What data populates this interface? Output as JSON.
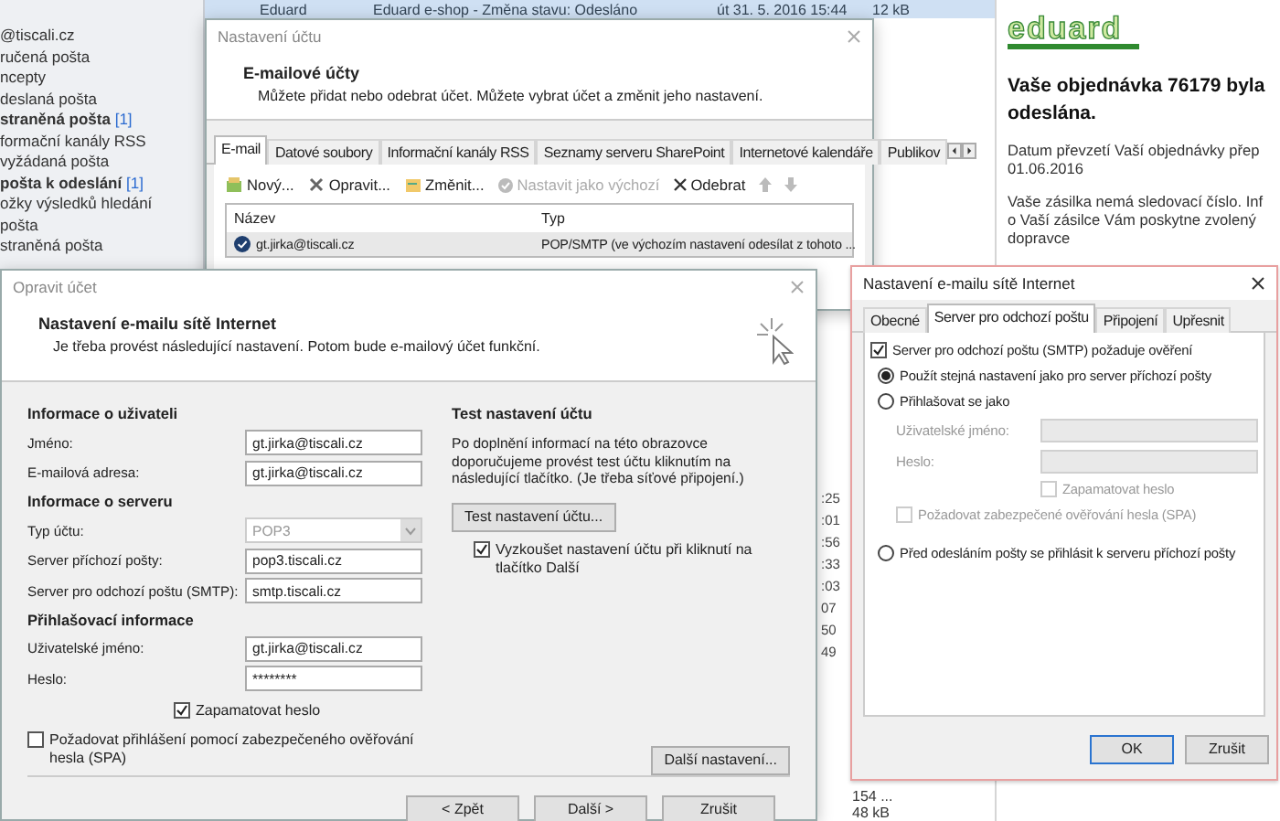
{
  "message_row": {
    "sender": "Eduard",
    "subject": "Eduard e-shop - Změna stavu: Odesláno",
    "date": "út 31. 5. 2016 15:44",
    "size": "12 kB"
  },
  "folders": [
    {
      "label": "@tiscali.cz",
      "unread": false
    },
    {
      "label": "ručená pošta",
      "unread": false
    },
    {
      "label": "ncepty",
      "unread": false
    },
    {
      "label": "deslaná pošta",
      "unread": false
    },
    {
      "label": "straněná pošta",
      "unread": true,
      "count": "[1]"
    },
    {
      "label": "formační kanály RSS",
      "unread": false
    },
    {
      "label": "vyžádaná pošta",
      "unread": false
    },
    {
      "label": "pošta k odeslání",
      "unread": true,
      "count": "[1]"
    },
    {
      "label": "ožky výsledků hledání",
      "unread": false
    },
    {
      "label": "pošta",
      "unread": false
    },
    {
      "label": "straněná pošta",
      "unread": false
    }
  ],
  "list_fragments": [
    ":25",
    ":01",
    ":56",
    ":33",
    ":03",
    "07",
    "50",
    "49"
  ],
  "list_sizes": [
    "154 ...",
    "48 kB"
  ],
  "reading_pane": {
    "logo": "eduard",
    "heading_lines": [
      "Vaše objednávka 76179 byla",
      "odeslána."
    ],
    "paragraphs": [
      [
        "Datum převzetí Vaší objednávky přep",
        "01.06.2016"
      ],
      [
        "Vaše zásilka nemá sledovací číslo. Inf",
        "o Vaší zásilce Vám poskytne zvolený",
        "dopravce"
      ]
    ]
  },
  "account_settings": {
    "title": "Nastavení účtu",
    "heading": "E-mailové účty",
    "subtitle": "Můžete přidat nebo odebrat účet. Můžete vybrat účet a změnit jeho nastavení.",
    "tabs": [
      {
        "label": "E-mail",
        "selected": true
      },
      {
        "label": "Datové soubory",
        "selected": false
      },
      {
        "label": "Informační kanály RSS",
        "selected": false
      },
      {
        "label": "Seznamy serveru SharePoint",
        "selected": false
      },
      {
        "label": "Internetové kalendáře",
        "selected": false
      },
      {
        "label": "Publikov",
        "selected": false
      }
    ],
    "toolbar": [
      {
        "kind": "new",
        "label": "Nový...",
        "disabled": false
      },
      {
        "kind": "repair",
        "label": "Opravit...",
        "disabled": false
      },
      {
        "kind": "change",
        "label": "Změnit...",
        "disabled": false
      },
      {
        "kind": "default",
        "label": "Nastavit jako výchozí",
        "disabled": true
      },
      {
        "kind": "remove",
        "label": "Odebrat",
        "disabled": false
      }
    ],
    "columns": [
      "Název",
      "Typ"
    ],
    "rows": [
      {
        "name": "gt.jirka@tiscali.cz",
        "type": "POP/SMTP (ve výchozím nastavení odesílat z tohoto ...",
        "default": true
      }
    ]
  },
  "repair_account": {
    "title": "Opravit účet",
    "heading": "Nastavení e-mailu sítě Internet",
    "subtitle": "Je třeba provést následující nastavení. Potom bude e-mailový účet funkční.",
    "sections": [
      {
        "title": "Informace o uživateli",
        "fields": [
          {
            "kind": "text",
            "label": "Jméno:",
            "value": "gt.jirka@tiscali.cz"
          },
          {
            "kind": "text",
            "label": "E-mailová adresa:",
            "value": "gt.jirka@tiscali.cz"
          }
        ]
      },
      {
        "title": "Informace o serveru",
        "fields": [
          {
            "kind": "select",
            "label": "Typ účtu:",
            "value": "POP3",
            "disabled": true
          },
          {
            "kind": "text",
            "label": "Server příchozí pošty:",
            "value": "pop3.tiscali.cz"
          },
          {
            "kind": "text",
            "label": "Server pro odchozí poštu (SMTP):",
            "value": "smtp.tiscali.cz"
          }
        ]
      },
      {
        "title": "Přihlašovací informace",
        "fields": [
          {
            "kind": "text",
            "label": "Uživatelské jméno:",
            "value": "gt.jirka@tiscali.cz"
          },
          {
            "kind": "password",
            "label": "Heslo:",
            "value": "********"
          }
        ]
      }
    ],
    "remember_password": {
      "label": "Zapamatovat heslo",
      "checked": true
    },
    "spa": {
      "label": "Požadovat přihlášení pomocí zabezpečeného ověřování hesla (SPA)",
      "checked": false
    },
    "test": {
      "title": "Test nastavení účtu",
      "text": "Po doplnění informací na této obrazovce doporučujeme provést test účtu kliknutím na následující tlačítko. (Je třeba síťové připojení.)",
      "button": "Test nastavení účtu...",
      "auto_test": {
        "label": "Vyzkoušet nastavení účtu při kliknutí na tlačítko Další",
        "checked": true
      }
    },
    "more_settings": "Další nastavení...",
    "buttons": [
      "< Zpět",
      "Další >",
      "Zrušit"
    ]
  },
  "internet_settings": {
    "title": "Nastavení e-mailu sítě Internet",
    "tabs": [
      {
        "label": "Obecné",
        "selected": false
      },
      {
        "label": "Server pro odchozí poštu",
        "selected": true
      },
      {
        "label": "Připojení",
        "selected": false
      },
      {
        "label": "Upřesnit",
        "selected": false
      }
    ],
    "requires_auth": {
      "label": "Server pro odchozí poštu (SMTP) požaduje ověření",
      "checked": true
    },
    "options": [
      {
        "kind": "radio",
        "label": "Použít stejná nastavení jako pro server příchozí pošty",
        "selected": true
      },
      {
        "kind": "radio",
        "label": "Přihlašovat se jako",
        "selected": false
      },
      {
        "kind": "field",
        "label": "Uživatelské jméno:",
        "disabled": true
      },
      {
        "kind": "field",
        "label": "Heslo:",
        "disabled": true
      },
      {
        "kind": "field_check",
        "label": "Zapamatovat heslo",
        "checked": false,
        "disabled": true
      },
      {
        "kind": "check",
        "label": "Požadovat zabezpečené ověřování hesla (SPA)",
        "checked": false,
        "disabled": true
      },
      {
        "kind": "gap"
      },
      {
        "kind": "radio",
        "label": "Před odesláním pošty se přihlásit k serveru příchozí pošty",
        "selected": false
      }
    ],
    "buttons": [
      {
        "label": "OK",
        "default": true
      },
      {
        "label": "Zrušit",
        "default": false
      }
    ]
  }
}
